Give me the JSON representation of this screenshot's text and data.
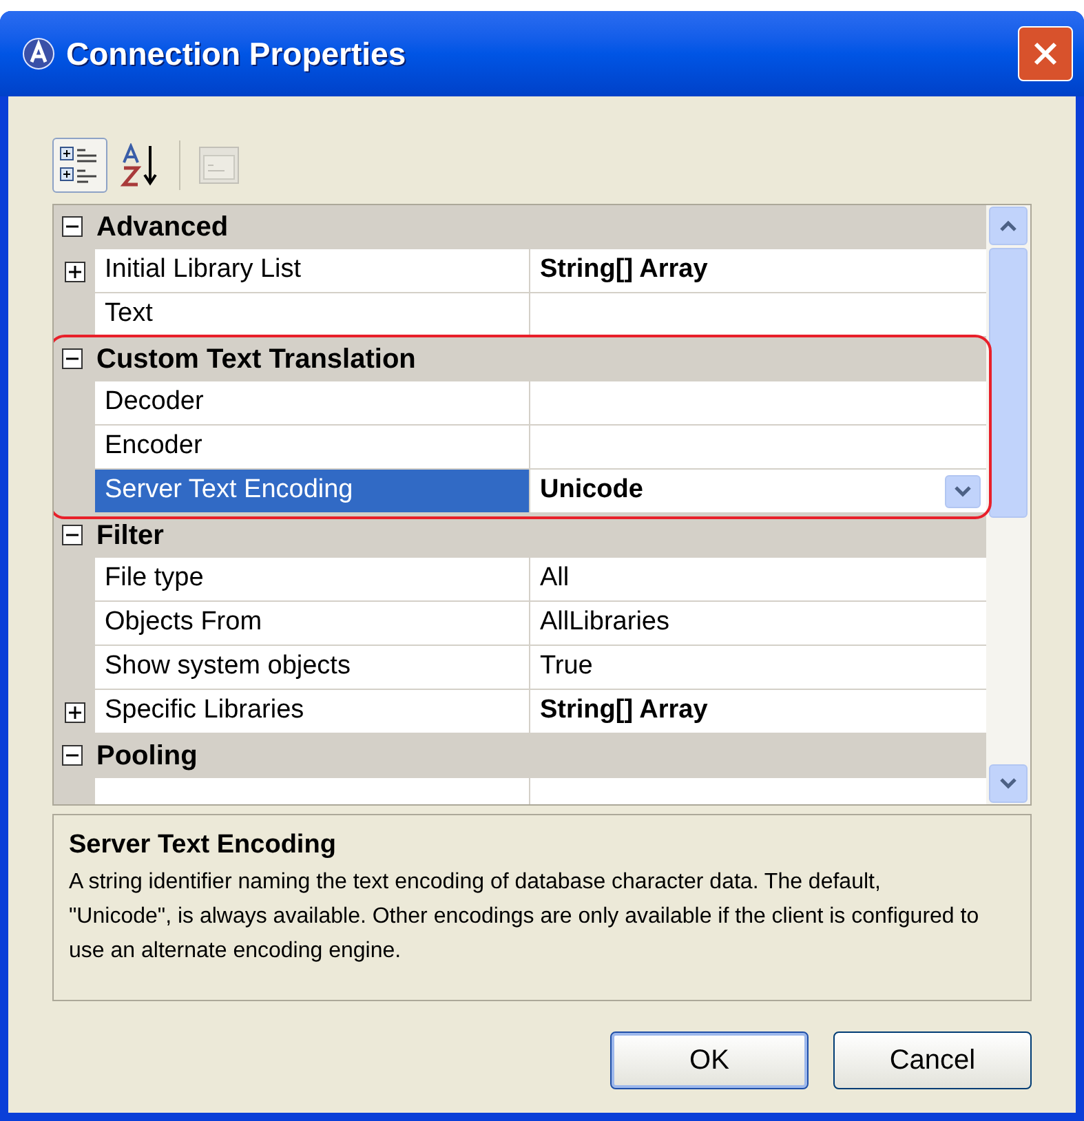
{
  "window": {
    "title": "Connection Properties"
  },
  "toolbar": [
    {
      "kind": "categorized",
      "selected": true,
      "disabled": false
    },
    {
      "kind": "alphabetical",
      "selected": false,
      "disabled": false
    },
    {
      "kind": "pages",
      "selected": false,
      "disabled": true
    }
  ],
  "categories": [
    {
      "name": "Advanced",
      "expanded": true,
      "properties": [
        {
          "name": "Initial Library List",
          "value": "String[] Array",
          "expandable": true,
          "modified": true,
          "selected": false
        },
        {
          "name": "Text",
          "expandable": false,
          "modified": false,
          "selected": false
        }
      ]
    },
    {
      "name": "Custom Text Translation",
      "expanded": true,
      "highlighted": true,
      "properties": [
        {
          "name": "Decoder",
          "expandable": false,
          "modified": false,
          "selected": false
        },
        {
          "name": "Encoder",
          "expandable": false,
          "modified": false,
          "selected": false
        },
        {
          "name": "Server Text Encoding",
          "value": "Unicode",
          "expandable": false,
          "modified": true,
          "selected": true
        }
      ]
    },
    {
      "name": "Filter",
      "expanded": true,
      "properties": [
        {
          "name": "File type",
          "value": "All",
          "expandable": false,
          "modified": false,
          "selected": false
        },
        {
          "name": "Objects From",
          "value": "AllLibraries",
          "expandable": false,
          "modified": false,
          "selected": false
        },
        {
          "name": "Show system objects",
          "value": "True",
          "expandable": false,
          "modified": false,
          "selected": false
        },
        {
          "name": "Specific Libraries",
          "value": "String[] Array",
          "expandable": true,
          "modified": true,
          "selected": false
        }
      ]
    },
    {
      "name": "Pooling",
      "expanded": true
    }
  ],
  "description": {
    "title": "Server Text Encoding",
    "text": "A string identifier naming the text encoding of database character data. The default, \"Unicode\", is always available.  Other encodings are only available if the client is configured to use an alternate encoding engine."
  },
  "buttons": [
    "OK",
    "Cancel"
  ]
}
